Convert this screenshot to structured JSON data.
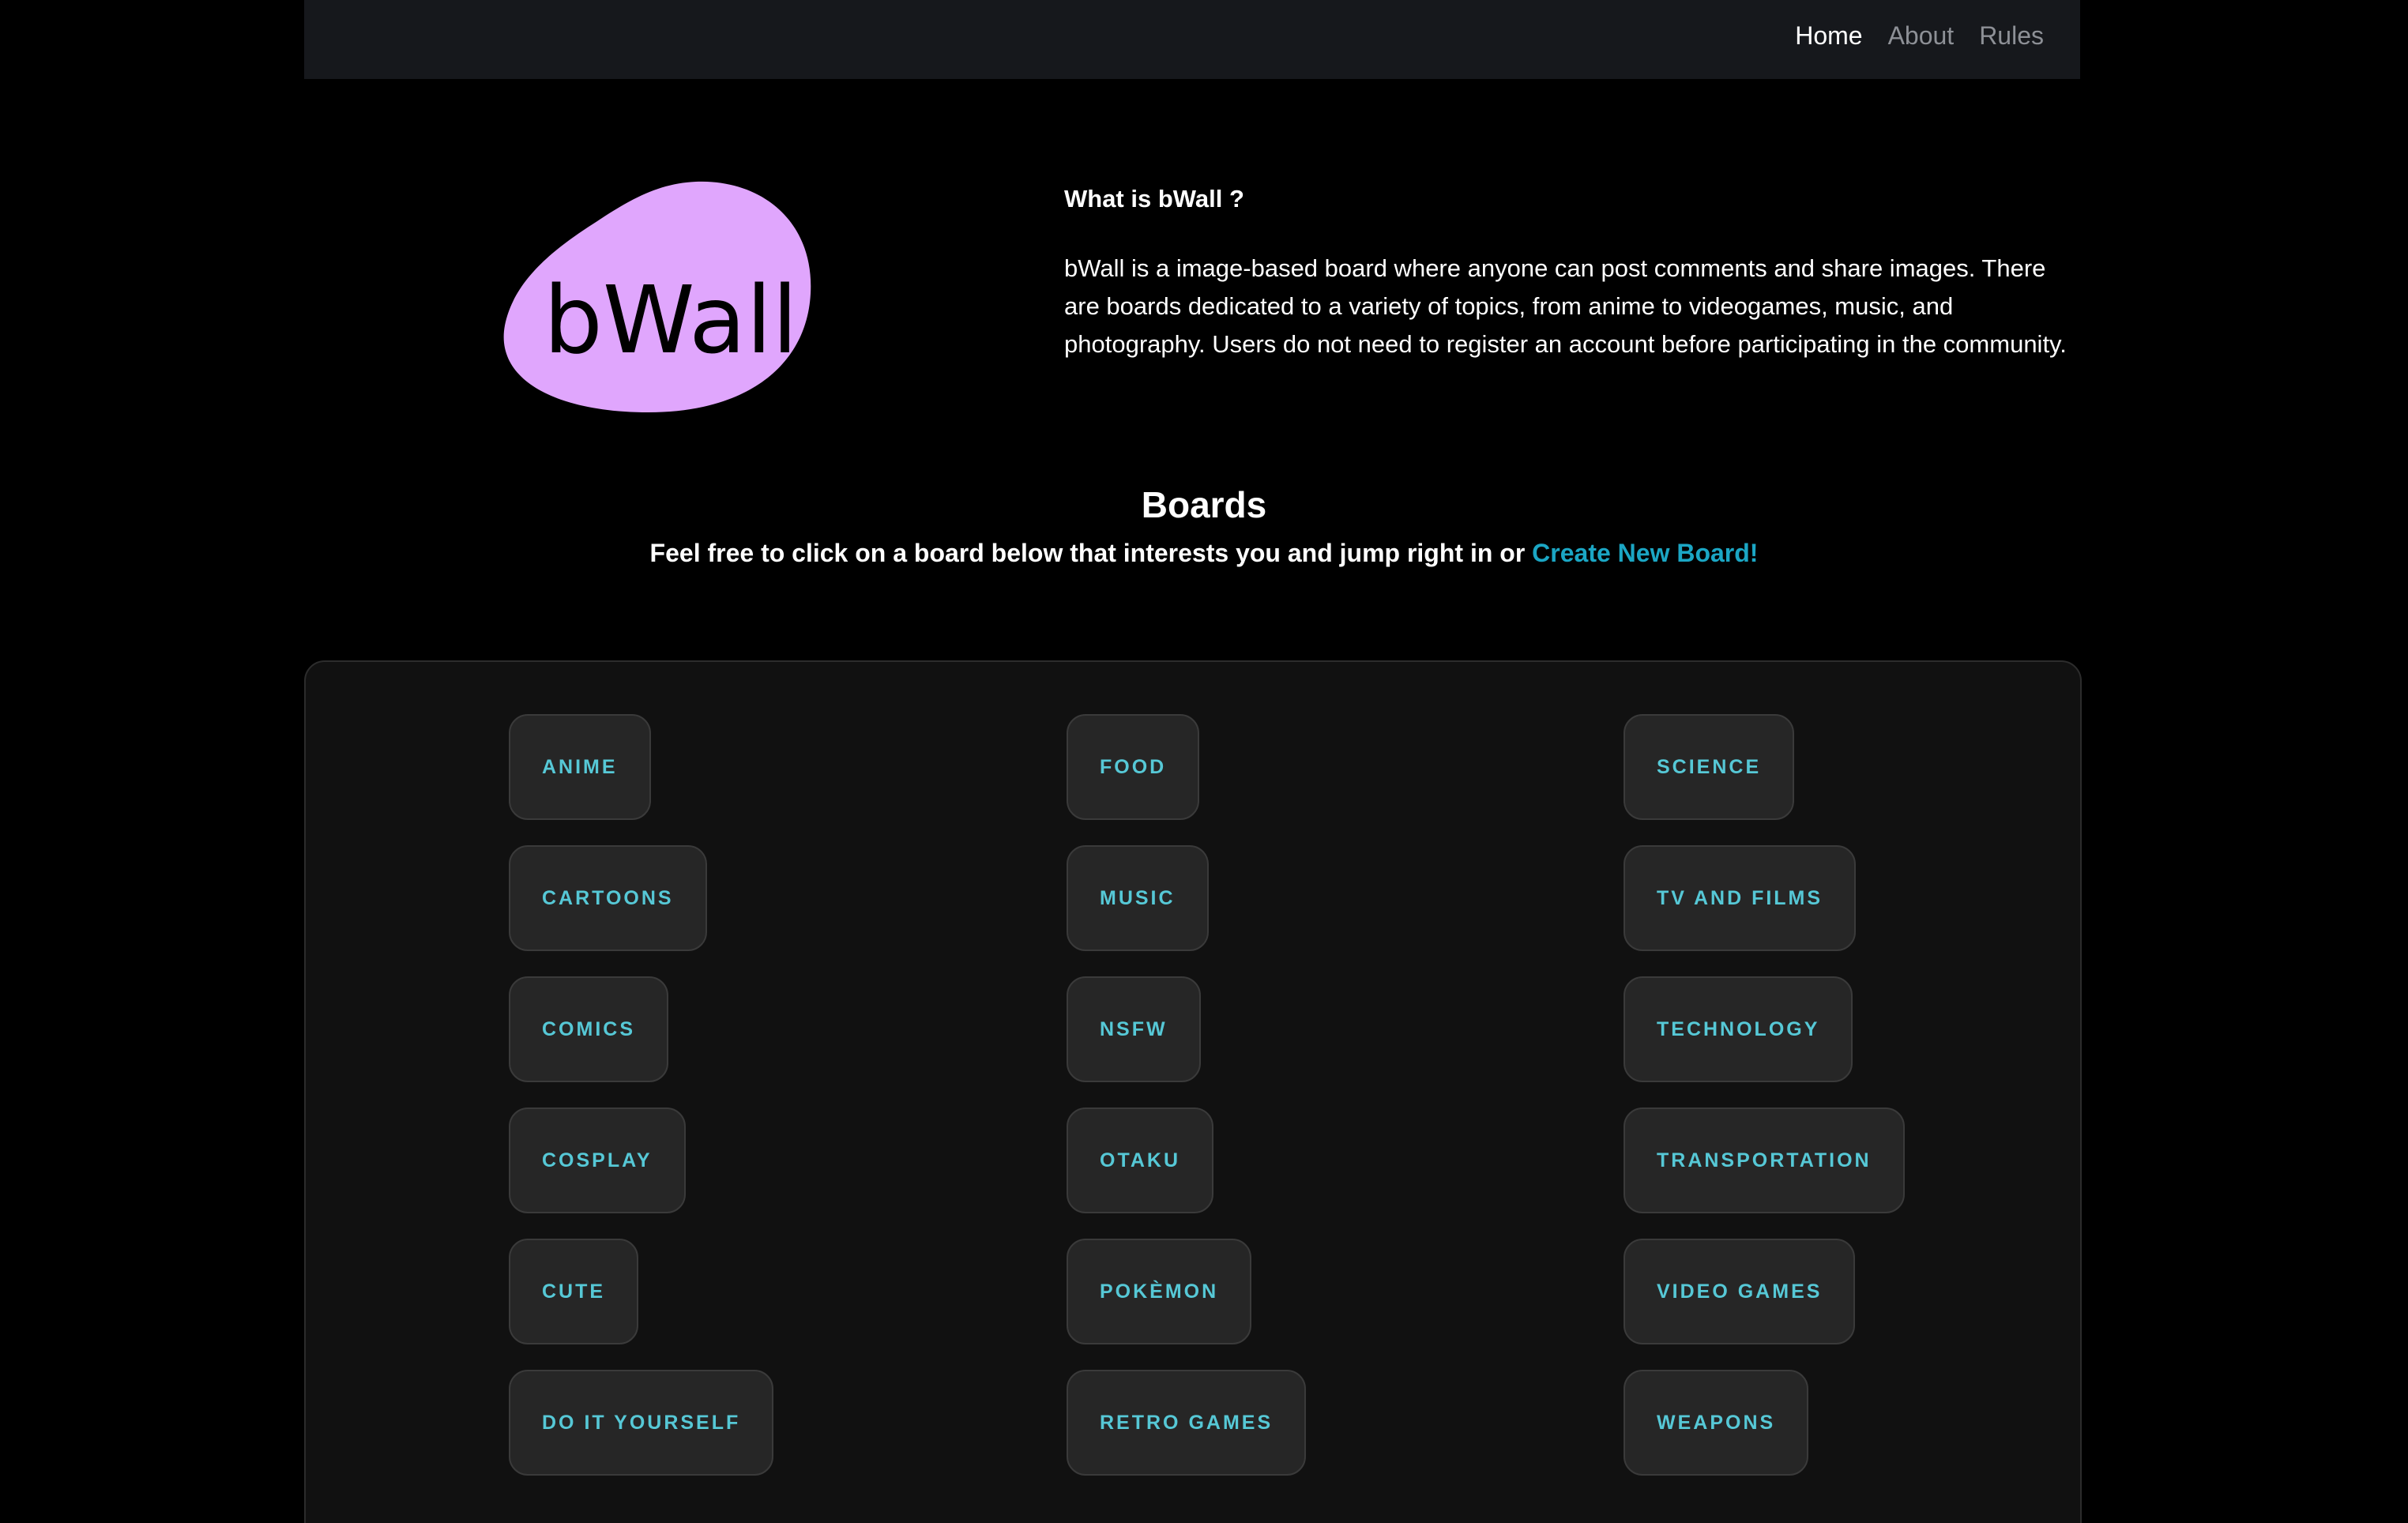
{
  "nav": {
    "links": [
      {
        "label": "Home",
        "active": true
      },
      {
        "label": "About",
        "active": false
      },
      {
        "label": "Rules",
        "active": false
      }
    ]
  },
  "logo": {
    "text": "bWall",
    "color": "#e0a6fd"
  },
  "about": {
    "title": "What is bWall ?",
    "text": "bWall is a image-based board where anyone can post comments and share images. There are boards dedicated to a variety of topics, from anime to videogames, music, and photography. Users do not need to register an account before participating in the community."
  },
  "boards": {
    "heading": "Boards",
    "subtitle": "Feel free to click on a board below that interests you and jump right in or",
    "create_link": "Create New Board!",
    "columns": [
      [
        "ANIME",
        "CARTOONS",
        "COMICS",
        "COSPLAY",
        "CUTE",
        "DO IT YOURSELF"
      ],
      [
        "FOOD",
        "MUSIC",
        "NSFW",
        "OTAKU",
        "POKÈMON",
        "RETRO GAMES"
      ],
      [
        "SCIENCE",
        "TV AND FILMS",
        "TECHNOLOGY",
        "TRANSPORTATION",
        "VIDEO GAMES",
        "WEAPONS"
      ]
    ]
  },
  "colors": {
    "accent": "#1ba6c4",
    "board_text": "#56c8d6",
    "navbar_bg": "#16181c",
    "panel_bg": "#111111"
  }
}
